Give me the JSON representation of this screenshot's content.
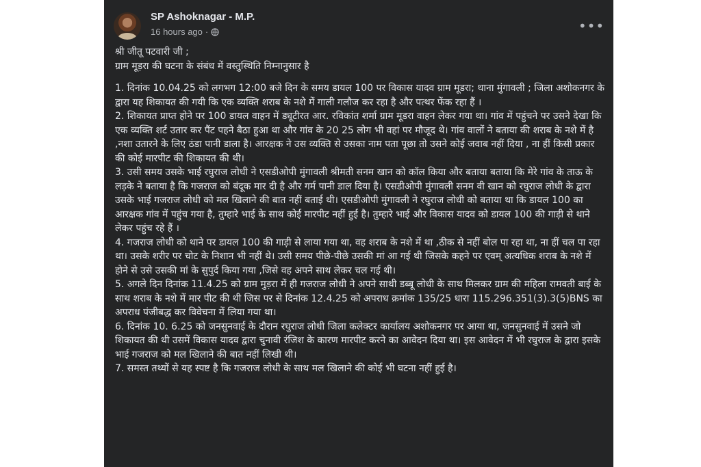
{
  "post": {
    "author": "SP Ashoknagar - M.P.",
    "time": "16 hours ago",
    "separator": "·",
    "more": "•••",
    "greeting": "श्री जीतू पटवारी जी ;",
    "subject": "ग्राम मूड़रा की घटना के संबंध में वस्तुस्थिति निम्नानुसार है",
    "paragraphs": [
      "1.  दिनांक 10.04.25 को लगभग 12:00 बजे दिन के समय डायल 100 पर विकास यादव ग्राम मूडरा; थाना मुंगावली ; जिला अशोकनगर के द्वारा यह शिकायत की गयी कि एक व्यक्ति शराब के नशे में गाली गलौज कर रहा है और पत्थर फेंक रहा हैं ।",
      "2. शिकायत प्राप्त होने पर 100 डायल वाहन में ड्यूटीरत आर.  रविकांत शर्मा ग्राम मूडरा वाहन लेकर गया था। गांव में पहुंचने पर उसने देखा कि एक व्यक्ति शर्ट उतार कर  पैंट पहने बैठा हुआ था और गांव  के 20 25 लोग भी वहां पर मौजूद थे। गांव वालों ने बताया की शराब के नशे में है ,नशा उतारने के लिए ठंडा पानी डाला  है।  आरक्षक ने उस व्यक्ति से  उसका नाम पता पूछा तो उसने कोई जवाब नहीं दिया , ना हीं किसी प्रकार की कोई मारपीट की शिकायत की थी।",
      "3. उसी समय उसके भाई रघुराज लोधी ने एसडीओपी मुंगावली श्रीमती सनम खान को कॉल किया और बताया बताया कि मेरे गांव के ताऊ के लड़के ने बताया है कि गजराज को बंदूक मार दी है  और  गर्म पानी डाल दिया है।  एसडीओपी मुंगावली सनम वी खान को रघुराज लोधी के द्वारा उसके भाई गजराज लोधी को  मल  खिलाने की बात नहीं बताई थी।  एसडीओपी मुंगावली  ने रघुराज लोधी को बताया था कि डायल 100 का आरक्षक गांव में पहुंच गया है, तुम्हारे भाई के साथ कोई मारपीट नहीं हुई है।  तुम्हारे भाई और विकास यादव को डायल 100 की गाड़ी से  थाने  लेकर पहुंच रहे हैं ।",
      "4. गजराज लोधी को थाने पर  डायल 100 की गाड़ी से लाया गया था, वह  शराब के नशे में था ,ठीक से नहीं बोल पा रहा था, ना हीं चल पा रहा था। उसके शरीर पर चोट के निशान भी नहीं थे। उसी समय पीछे-पीछे उसकी मां आ गई थी जिसके कहने पर एवम्  अत्यधिक शराब के नशे में होने से उसे  उसकी मां के सुपुर्द किया गया ,जिसे वह अपने साथ लेकर चल गई थी।",
      "5. अगले दिन दिनांक 11.4.25 को ग्राम मुड़रा में ही गजराज लोधी ने अपने साथी डब्बू लोधी के साथ मिलकर ग्राम की महिला रामवती बाई के साथ शराब के नशे में मार पीट की थी जिस पर से दिनांक 12.4.25 को अपराध क्रमांक 135/25 धारा 115.296.351(3).3(5)BNS का अपराध पंजीबद्ध कर विवेचना में लिया गया था।",
      "6. दिनांक 10. 6.25 को जनसुनवाई के दौरान रघुराज लोधी जिला कलेक्टर कार्यालय अशोकनगर पर आया था, जनसुनवाई में उसने जो शिकायत की थी उसमें विकास यादव द्वारा चुनावी रंजिश के कारण मारपीट करने का आवेदन दिया था। इस आवेदन में भी रघुराज के द्वारा इसके भाई गजराज को मल खिलाने की बात नहीं लिखी  थी।",
      "7. समस्त तथ्यों से यह स्पष्ट है कि गजराज लोधी के साथ मल खिलाने की कोई भी घटना नहीं हुई है।"
    ]
  }
}
